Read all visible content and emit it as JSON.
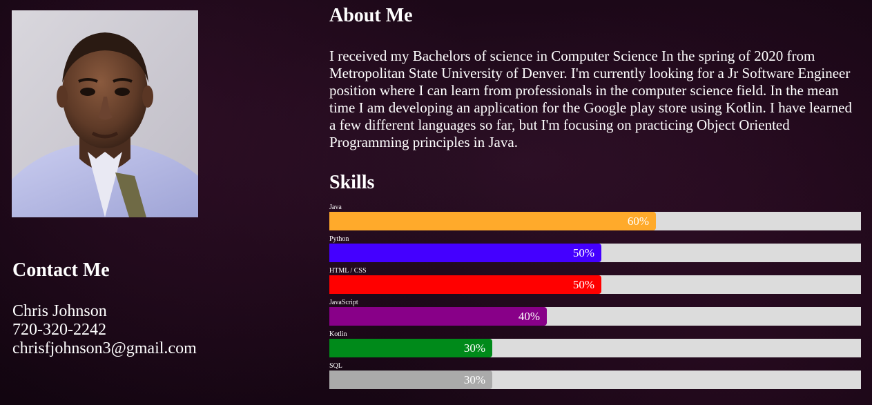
{
  "profile": {
    "photo_alt": "Chris Johnson portrait"
  },
  "about": {
    "title": "About Me",
    "text": "I received my Bachelors of science in Computer Science In the spring of 2020 from Metropolitan State University of Denver. I'm currently looking for a Jr Software Engineer position where I can learn from professionals in the computer science field. In the mean time I am developing an application for the Google play store using Kotlin. I have learned a few different languages so far, but I'm focusing on practicing Object Oriented Programming principles in Java."
  },
  "contact": {
    "title": "Contact Me",
    "name": "Chris Johnson",
    "phone": "720-320-2242",
    "email": "chrisfjohnson3@gmail.com"
  },
  "skills": {
    "title": "Skills",
    "items": [
      {
        "name": "Java",
        "label": "60%",
        "percent": 60,
        "color": "#ffaa2b",
        "name_key": "java"
      },
      {
        "name": "Python",
        "label": "50%",
        "percent": 50,
        "color": "#4400ff",
        "name_key": "python"
      },
      {
        "name": "HTML / CSS",
        "label": "50%",
        "percent": 50,
        "color": "#ff0000",
        "name_key": "html-css"
      },
      {
        "name": "JavaScript",
        "label": "40%",
        "percent": 40,
        "color": "#880088",
        "name_key": "javascript"
      },
      {
        "name": "Kotlin",
        "label": "30%",
        "percent": 30,
        "color": "#008a1a",
        "name_key": "kotlin"
      },
      {
        "name": "SQL",
        "label": "30%",
        "percent": 30,
        "color": "#aaaaaa",
        "name_key": "sql"
      }
    ]
  }
}
